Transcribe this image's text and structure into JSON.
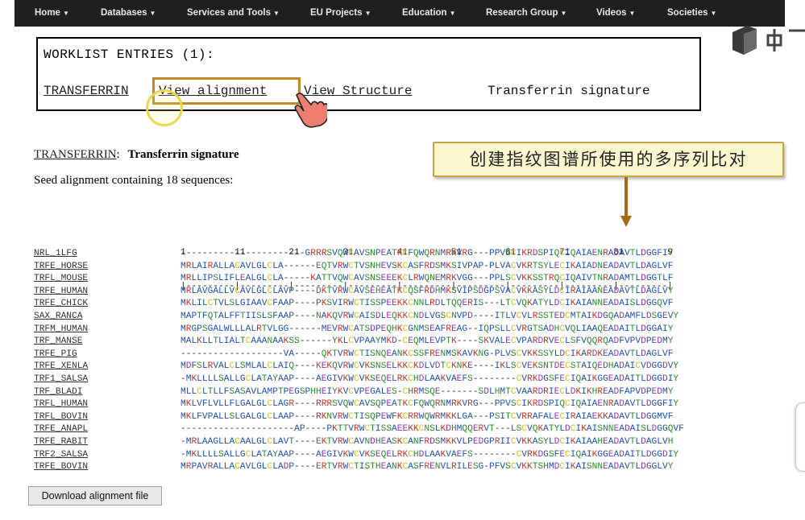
{
  "nav": {
    "items": [
      "Home",
      "Databases",
      "Services and Tools",
      "EU Projects",
      "Education",
      "Research Group",
      "Videos",
      "Societies"
    ]
  },
  "worklist": {
    "title": "WORKLIST ENTRIES (1):",
    "links": [
      "TRANSFERRIN",
      "View alignment",
      "View Structure"
    ],
    "signature": "Transferrin signature"
  },
  "content": {
    "name_link": "TRANSFERRIN",
    "colon": ":",
    "signature": "Transferrin signature",
    "seed_text": "Seed alignment containing 18 sequences:",
    "annotation": "创建指纹图谱所使用的多序列比对",
    "ruler_numbers": "1         11        21        31        41        51        61        71        81        9",
    "ruler_dashes": "|---------|---------|---------|---------|---------|---------|---------|---------|---------|"
  },
  "alignment": [
    {
      "name": "NRL_1LFG",
      "seq": "-----------------------GRRRSVQWCAVSNPEATKCFQWQRNMRKVRG---PPVSCIKRDSPIQCIQAIAENRADAVTLDGGFIY"
    },
    {
      "name": "TRFE_HORSE",
      "seq": "MRLAIRALLACAVLGLCLA------EQTVRWCTVSNHEVSKCASFRDSMKSIVPAP-PLVACVKRTSYLECIKAIADNEADAVTLDAGLVF"
    },
    {
      "name": "TRFL_MOUSE",
      "seq": "MRLLIPSLIFLEALGLCLA-----KATTVQWCAVSNSEEEKCLRWQNEMRKVGG---PPLSCVKKSSTRQCIQAIVTNRADAMTLDGGTLF"
    },
    {
      "name": "TRFE_HUMAN",
      "seq": "MRLAVGALLVCAVLGLCLAVP----DKTVRWCAVSEHEATKCQSFRDHMKSVIPSDGPSVACVKKASYLDCIRAIAANEADAVTLDAGLVY"
    },
    {
      "name": "TRFE_CHICK",
      "seq": "MKLILCTVLSLGIAAVCFAAP----PKSVIRWCTISSPEEKKCNNLRDLTQQERIS---LTCVQKATYLDCIKAIANNEADAISLDGGQVF"
    },
    {
      "name": "SAX_RANCA",
      "seq": "MAPTFQTALFFTIISLSFAAP----NAKQVRWCAISDLEQKKCNDLVGSCNVPD----ITLVCVLRSSTEDCMTAIKDGQADAMFLDSGEVY"
    },
    {
      "name": "TRFM_HUMAN",
      "seq": "MRGPSGALWLLLALRTVLGG------MEVRWCATSDPEQHKCGNMSEAFREAG--IQPSLLCVRGTSADHCVQLIAAQEADAITLDGGAIY"
    },
    {
      "name": "TRF_MANSE",
      "seq": "MALKLLTLIALTCAAANAAKSS------YKLCVPAAYMKD-CEQMLEVPTK----SKVALECVPARDRVECLSFVQQRQADFVPVDPEDMY"
    },
    {
      "name": "TRFE_PIG",
      "seq": "-------------------VA-----QKTVRWCTISNQEANKCSSFRENMSKAVKNG-PLVSCVKKSSYLDCIKARDKEADAVTLDAGLVF"
    },
    {
      "name": "TRFE_XENLA",
      "seq": "MDFSLRVALCLSMLALCLAIQ----KEKQVRWCVKSNSELKKCKDLVDTCKNKE----IKLSCVEKSNTDECSTAIQEDHADAICVDGGDVY"
    },
    {
      "name": "TRF1_SALSA",
      "seq": "-MKLLLLSALLGCLATAYAAP----AEGIVKWCVKSEQELRKCHDLAAKVAEFS--------CVRKDGSFECIQAIKGGEADAITLDGGDIY"
    },
    {
      "name": "TRF_BLADI",
      "seq": "MLLCLTLLFSASAVLAMPTPEGSPHHEIYKVCVPEGALES-CHRMSQE-------SDLHMTCVAARDRIECLDKIKHREADFAPVDPEDMY"
    },
    {
      "name": "TRFL_HUMAN",
      "seq": "MKLVFLVLLFLGALGLCLAGR----RRRSVQWCAVSQPEATKCFQWQRNMRKVRG---PPVSCIKRDSPIQCIQAIAENRADAVTLDGGFIY"
    },
    {
      "name": "TRFL_BOVIN",
      "seq": "MKLFVPALLSLGALGLCLAAP----RKNVRWCTISQPEWFKCRRWQWRMKKLGA---PSITCVRRAFALECIRAIAEKKADAVTLDGGMVF"
    },
    {
      "name": "TRFE_ANAPL",
      "seq": "---------------------AP----PKTTVRWCTISSAEEKKCNSLKDHMQQERVT---LSCVQKATYLDCIKAISNNEADAISLDGGQVF"
    },
    {
      "name": "TRFE_RABIT",
      "seq": "-MRLAAGLLACAALGLCLAVT----EKTVRWCAVNDHEASKCANFRDSMKKVLPEDGPRIICVKKASYLDCIKAIAAHEADAVTLDAGLVH"
    },
    {
      "name": "TRF2_SALSA",
      "seq": "-MKLLLLSALLGCLATAYAAP----AEGIVKWCVKSEQELRKCHDLAAKVAEFS--------CVRKDGSFECIQAIKGGEADAITLDGGDIY"
    },
    {
      "name": "TRFE_BOVIN",
      "seq": "MRPAVRALLACAVLGLCLADP----ERTVRWCTISTHEANKCASFRENVLRILESG-PFVSCVKKTSHMDCIKAISNNEADAVTLDGGLVY"
    }
  ],
  "download_button": "Download alignment file",
  "colors": {
    "navbar": "#1f1f1f",
    "hydrophobic": "#1f4fb8",
    "polar": "#2c8a2c",
    "positive": "#c0392b",
    "negative": "#8a3aa8",
    "cysteine": "#d6c21e",
    "gap": "#333333",
    "annotation_bg": "#fbf7cf",
    "highlight": "#c08a2a"
  }
}
